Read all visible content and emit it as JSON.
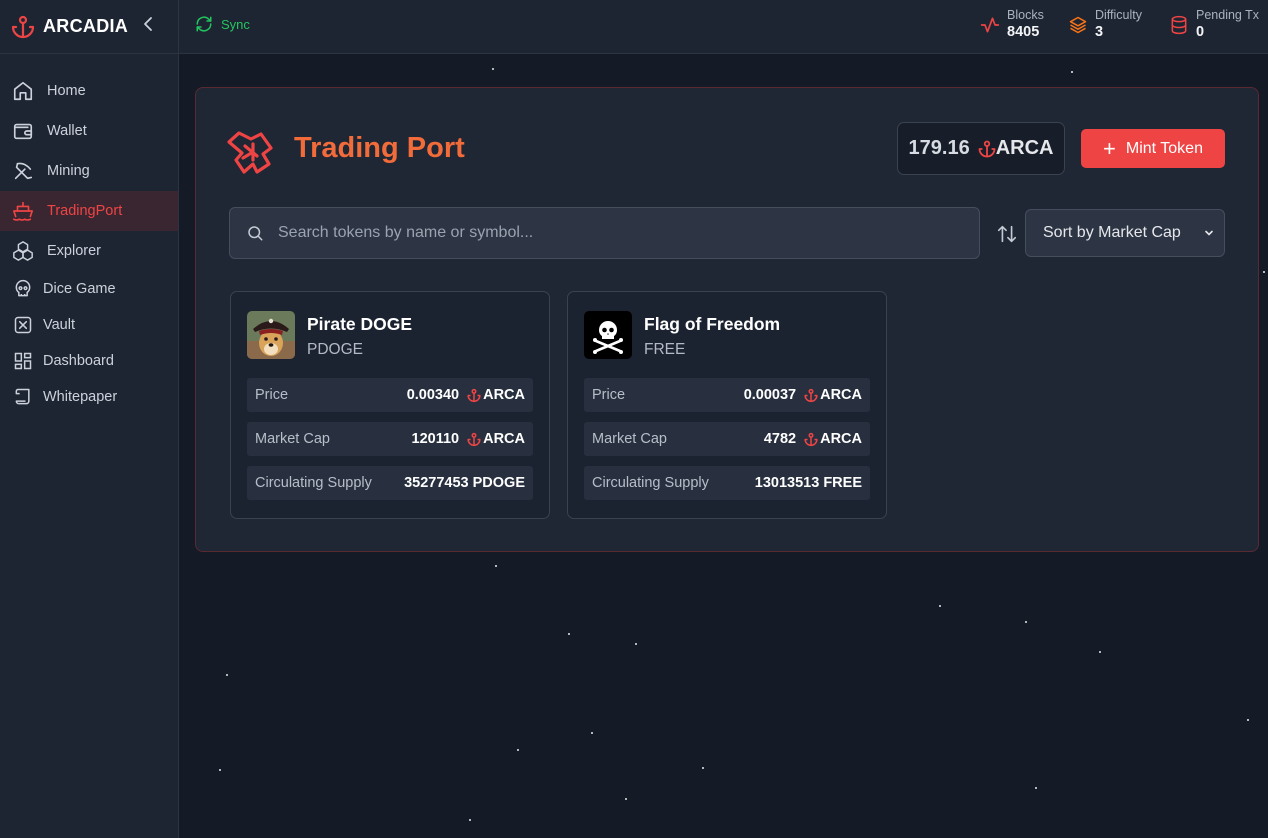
{
  "app": {
    "name": "ARCADIA",
    "brand_color": "#ef4444"
  },
  "sidebar": {
    "items": [
      {
        "label": "Home",
        "icon": "home-icon"
      },
      {
        "label": "Wallet",
        "icon": "wallet-icon"
      },
      {
        "label": "Mining",
        "icon": "pickaxe-icon"
      },
      {
        "label": "TradingPort",
        "icon": "ship-icon",
        "active": true
      },
      {
        "label": "Explorer",
        "icon": "boxes-icon"
      },
      {
        "label": "Dice Game",
        "icon": "skull-icon"
      },
      {
        "label": "Vault",
        "icon": "vault-icon"
      },
      {
        "label": "Dashboard",
        "icon": "dashboard-icon"
      },
      {
        "label": "Whitepaper",
        "icon": "scroll-icon"
      }
    ]
  },
  "topbar": {
    "sync_label": "Sync",
    "stats": [
      {
        "label": "Blocks",
        "value": "8405",
        "icon": "activity-icon"
      },
      {
        "label": "Difficulty",
        "value": "3",
        "icon": "layers-icon"
      },
      {
        "label": "Pending Tx",
        "value": "0",
        "icon": "database-icon"
      }
    ]
  },
  "main": {
    "title": "Trading Port",
    "balance": {
      "amount": "179.16",
      "unit": "ARCA"
    },
    "mint_label": "Mint Token",
    "search_placeholder": "Search tokens by name or symbol...",
    "sort_selected": "Sort by Market Cap",
    "tokens": [
      {
        "name": "Pirate DOGE",
        "symbol": "PDOGE",
        "rows": [
          {
            "label": "Price",
            "value": "0.00340",
            "unit": "ARCA"
          },
          {
            "label": "Market Cap",
            "value": "120110",
            "unit": "ARCA"
          },
          {
            "label": "Circulating Supply",
            "value": "35277453 PDOGE"
          }
        ]
      },
      {
        "name": "Flag of Freedom",
        "symbol": "FREE",
        "rows": [
          {
            "label": "Price",
            "value": "0.00037",
            "unit": "ARCA"
          },
          {
            "label": "Market Cap",
            "value": "4782",
            "unit": "ARCA"
          },
          {
            "label": "Circulating Supply",
            "value": "13013513 FREE"
          }
        ]
      }
    ]
  }
}
